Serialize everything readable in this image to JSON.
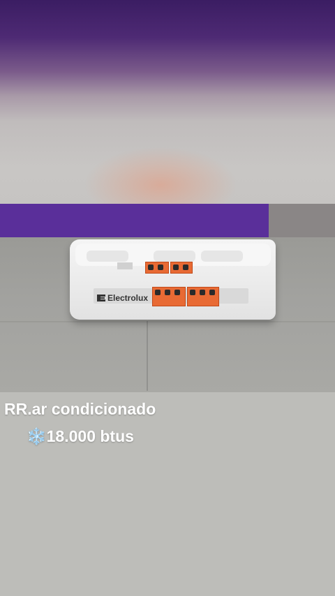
{
  "photo": {
    "brand_text": "Electrolux",
    "wall_color": "#4e2a74",
    "floor_color": "#a2a29f",
    "box_color": "#eeeeee",
    "warning_label_color": "#e86a34"
  },
  "caption": {
    "line1": "RR.ar condicionado",
    "line2_icon": "snowflake-icon",
    "line2": "❄️18.000 btus"
  },
  "background_color": "#bdbdb9"
}
